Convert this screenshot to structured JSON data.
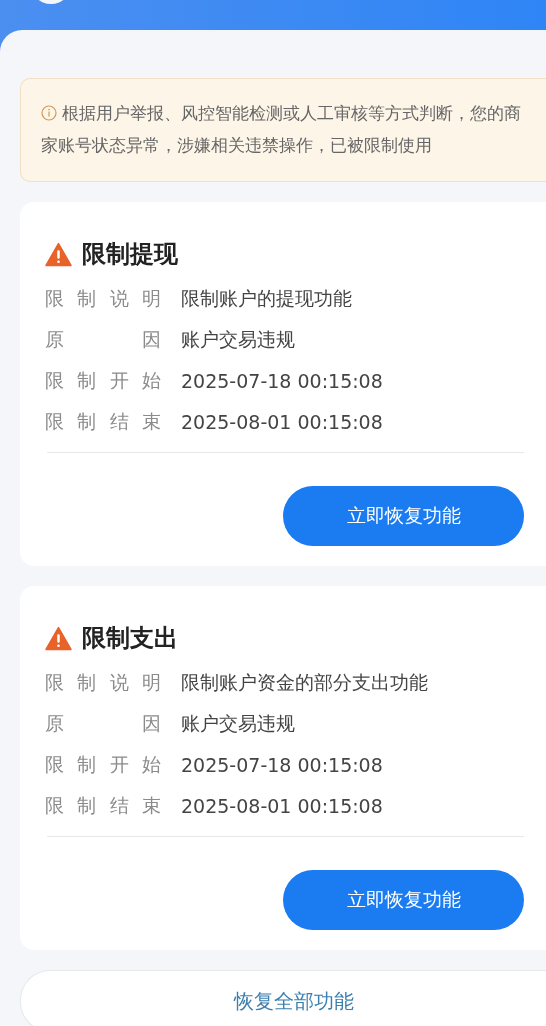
{
  "notice": {
    "text": "根据用户举报、风控智能检测或人工审核等方式判断，您的商家账号状态异常，涉嫌相关违禁操作，已被限制使用"
  },
  "restrictions": [
    {
      "title": "限制提现",
      "fields": [
        {
          "label": "限制说明",
          "value": "限制账户的提现功能"
        },
        {
          "label": "原因",
          "value": "账户交易违规"
        },
        {
          "label": "限制开始",
          "value": "2025-07-18 00:15:08"
        },
        {
          "label": "限制结束",
          "value": "2025-08-01 00:15:08"
        }
      ],
      "button": "立即恢复功能"
    },
    {
      "title": "限制支出",
      "fields": [
        {
          "label": "限制说明",
          "value": "限制账户资金的部分支出功能"
        },
        {
          "label": "原因",
          "value": "账户交易违规"
        },
        {
          "label": "限制开始",
          "value": "2025-07-18 00:15:08"
        },
        {
          "label": "限制结束",
          "value": "2025-08-01 00:15:08"
        }
      ],
      "button": "立即恢复功能"
    }
  ],
  "restore_all_button": "恢复全部功能"
}
